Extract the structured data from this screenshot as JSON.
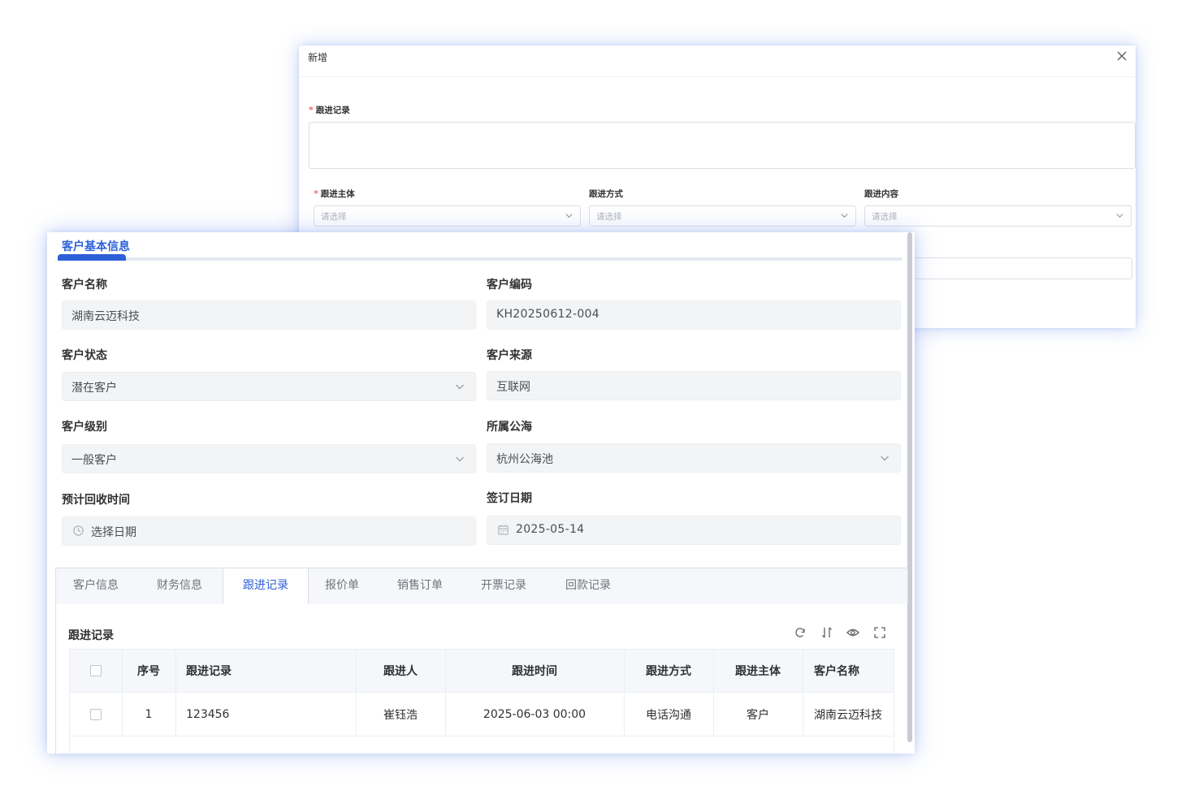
{
  "dialog": {
    "title": "新增",
    "follow_record_label": "跟进记录",
    "subject_label": "跟进主体",
    "method_label": "跟进方式",
    "content_label": "跟进内容",
    "select_placeholder": "请选择",
    "required_mark": "*"
  },
  "customer": {
    "section_title": "客户基本信息",
    "fields": {
      "name_label": "客户名称",
      "name_value": "湖南云迈科技",
      "code_label": "客户编码",
      "code_value": "KH20250612-004",
      "status_label": "客户状态",
      "status_value": "潜在客户",
      "source_label": "客户来源",
      "source_value": "互联网",
      "level_label": "客户级别",
      "level_value": "一般客户",
      "pool_label": "所属公海",
      "pool_value": "杭州公海池",
      "recycle_label": "预计回收时间",
      "recycle_placeholder": "选择日期",
      "sign_label": "签订日期",
      "sign_value": "2025-05-14"
    }
  },
  "tabs": [
    "客户信息",
    "财务信息",
    "跟进记录",
    "报价单",
    "销售订单",
    "开票记录",
    "回款记录"
  ],
  "active_tab": "跟进记录",
  "records": {
    "title": "跟进记录",
    "columns": [
      "序号",
      "跟进记录",
      "跟进人",
      "跟进时间",
      "跟进方式",
      "跟进主体",
      "客户名称"
    ],
    "rows": [
      [
        "1",
        "123456",
        "崔钰浩",
        "2025-06-03 00:00",
        "电话沟通",
        "客户",
        "湖南云迈科技"
      ]
    ]
  },
  "colors": {
    "accent": "#2d5fd6",
    "required": "#f56c6c",
    "field_bg": "#f3f4f6"
  },
  "icons": [
    "close-icon",
    "chevron-down-icon",
    "clock-icon",
    "calendar-icon",
    "refresh-icon",
    "column-sort-icon",
    "eye-icon",
    "fullscreen-icon"
  ]
}
